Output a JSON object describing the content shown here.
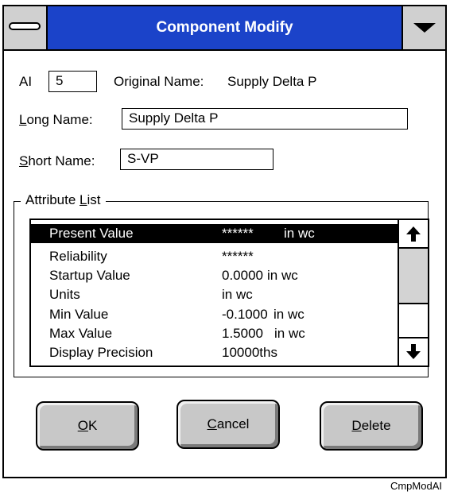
{
  "window": {
    "title": "Component Modify"
  },
  "form": {
    "ai_label": "AI",
    "ai_value": "5",
    "original_name_label": "Original Name:",
    "original_name_value": "Supply Delta P",
    "long_name_label_key": "L",
    "long_name_label_rest": "ong Name:",
    "long_name_value": "Supply Delta P",
    "short_name_label_key": "S",
    "short_name_label_rest": "hort Name:",
    "short_name_value": "S-VP"
  },
  "attribute_list": {
    "title_prefix": "Attribute ",
    "title_key": "L",
    "title_rest": "ist",
    "selected_index": 0,
    "rows": [
      {
        "name": "Present Value",
        "value": "******",
        "unit": "in wc"
      },
      {
        "name": "Reliability",
        "value": "******",
        "unit": ""
      },
      {
        "name": "Startup Value",
        "value": "0.0000",
        "unit": "in wc"
      },
      {
        "name": "Units",
        "value": "in wc",
        "unit": ""
      },
      {
        "name": "Min Value",
        "value": "-0.1000",
        "unit": "in wc"
      },
      {
        "name": "Max Value",
        "value": "1.5000",
        "unit": "in wc"
      },
      {
        "name": "Display Precision",
        "value": "10000ths",
        "unit": ""
      }
    ]
  },
  "buttons": {
    "ok_key": "O",
    "ok_rest": "K",
    "cancel_key": "C",
    "cancel_rest": "ancel",
    "delete_key": "D",
    "delete_rest": "elete"
  },
  "caption": "CmpModAI",
  "colors": {
    "titlebar": "#1b43c9",
    "button_face": "#c8c8c8",
    "selection": "#000000"
  },
  "icons": {
    "system_menu": "system-menu-icon",
    "dropdown": "dropdown-arrow-icon",
    "scroll_up": "arrow-up-icon",
    "scroll_down": "arrow-down-icon"
  }
}
